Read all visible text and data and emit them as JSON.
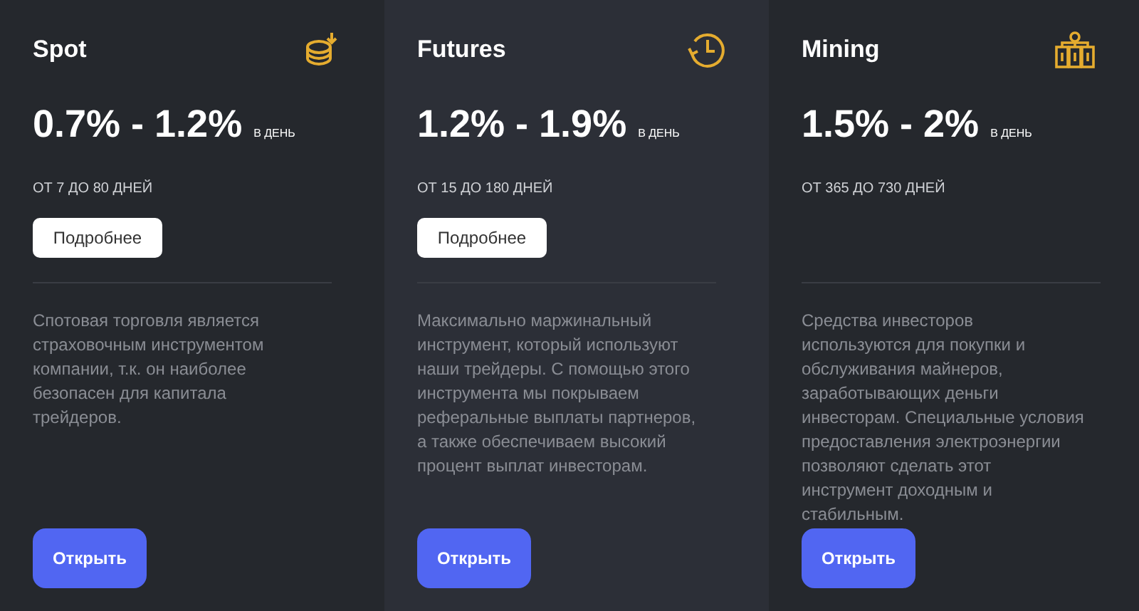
{
  "plans": [
    {
      "title": "Spot",
      "rate": "0.7% - 1.2%",
      "rate_unit": "В ДЕНЬ",
      "term": "ОТ 7 ДО 80 ДНЕЙ",
      "details_button": "Подробнее",
      "description": "Спотовая торговля является страховочным инструментом компании, т.к. он наиболее безопасен для капитала трейдеров.",
      "open_button": "Открыть"
    },
    {
      "title": "Futures",
      "rate": "1.2% - 1.9%",
      "rate_unit": "В ДЕНЬ",
      "term": "ОТ 15 ДО 180 ДНЕЙ",
      "details_button": "Подробнее",
      "description": "Максимально маржинальный инструмент, который используют наши трейдеры. С помощью этого инструмента мы покрываем реферальные выплаты партнеров, а также обеспечиваем высокий процент выплат инвесторам.",
      "open_button": "Открыть"
    },
    {
      "title": "Mining",
      "rate": "1.5% - 2%",
      "rate_unit": "В ДЕНЬ",
      "term": "ОТ 365 ДО 730 ДНЕЙ",
      "description": "Средства инвесторов используются для покупки и обслуживания майнеров, заработывающих деньги инвесторам. Специальные условия предоставления электроэнергии позволяют сделать этот инструмент доходным и стабильным.",
      "open_button": "Открыть"
    }
  ]
}
